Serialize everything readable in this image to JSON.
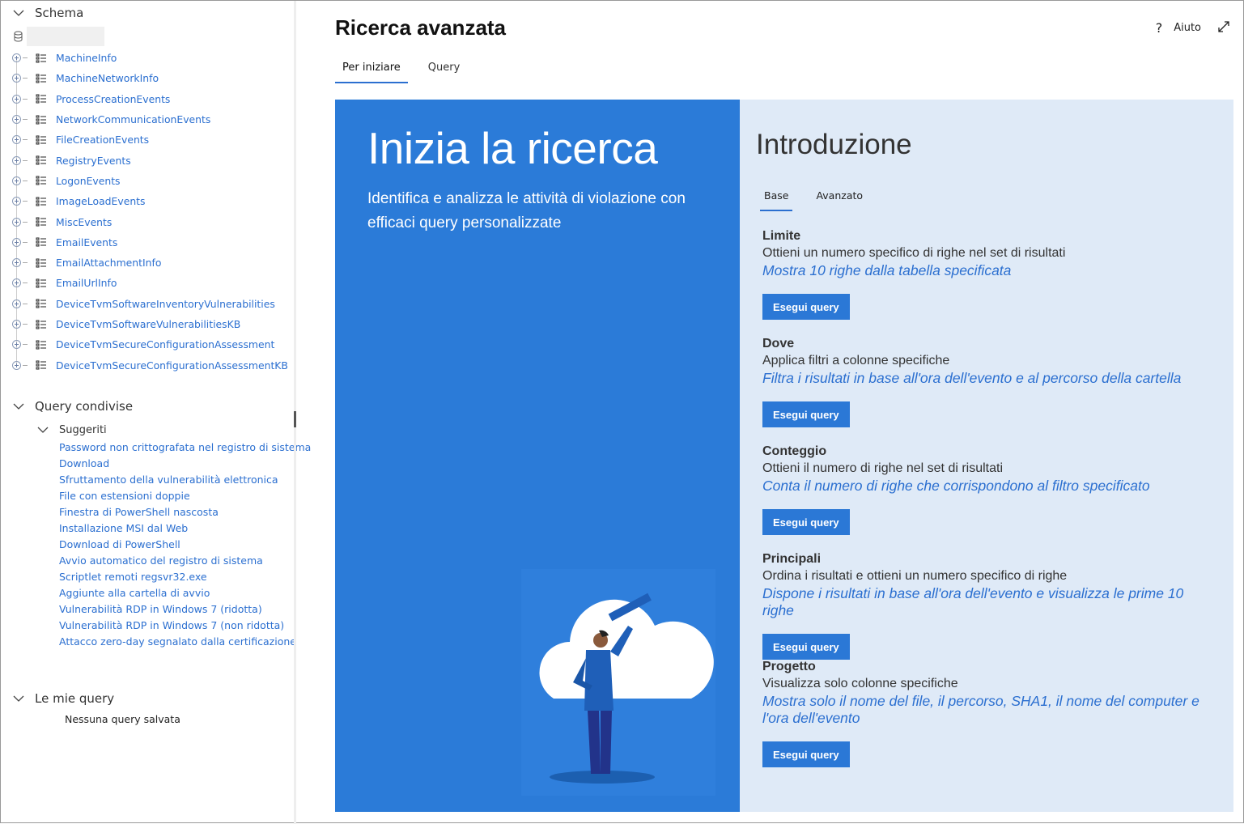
{
  "sidebar": {
    "schema_label": "Schema",
    "tables": [
      "MachineInfo",
      "MachineNetworkInfo",
      "ProcessCreationEvents",
      "NetworkCommunicationEvents",
      "FileCreationEvents",
      "RegistryEvents",
      "LogonEvents",
      "ImageLoadEvents",
      "MiscEvents",
      "EmailEvents",
      "EmailAttachmentInfo",
      "EmailUrlInfo",
      "DeviceTvmSoftwareInventoryVulnerabilities",
      "DeviceTvmSoftwareVulnerabilitiesKB",
      "DeviceTvmSecureConfigurationAssessment",
      "DeviceTvmSecureConfigurationAssessmentKB"
    ],
    "shared_label": "Query condivise",
    "suggested_label": "Suggeriti",
    "suggested": [
      "Password non crittografata nel registro di sistema",
      "Download",
      "Sfruttamento della vulnerabilità elettronica",
      "File con estensioni doppie",
      "Finestra di PowerShell nascosta",
      "Installazione MSI dal Web",
      "Download di PowerShell",
      "Avvio automatico del registro di sistema",
      "Scriptlet remoti regsvr32.exe",
      "Aggiunte alla cartella di avvio",
      "Vulnerabilità RDP in Windows 7 (ridotta)",
      "Vulnerabilità RDP in Windows 7 (non ridotta)",
      "Attacco zero-day segnalato dalla certificazione"
    ],
    "my_label": "Le mie query",
    "my_empty": "Nessuna query salvata"
  },
  "header": {
    "title": "Ricerca avanzata",
    "help": "Aiuto",
    "tabs": [
      "Per iniziare",
      "Query"
    ]
  },
  "hero": {
    "title": "Inizia la ricerca",
    "subtitle": "Identifica e analizza le attività di violazione con efficaci query personalizzate"
  },
  "intro": {
    "title": "Introduzione",
    "tabs": [
      "Base",
      "Avanzato"
    ],
    "examples": [
      {
        "title": "Limite",
        "desc": "Ottieni un numero specifico di righe nel set di risultati",
        "link": "Mostra 10 righe dalla tabella specificata",
        "button": "Esegui query"
      },
      {
        "title": "Dove",
        "desc": "Applica filtri a colonne specifiche",
        "link": "Filtra i risultati in base all'ora dell'evento e al percorso della cartella",
        "button": "Esegui query"
      },
      {
        "title": "Conteggio",
        "desc": "Ottieni il numero di righe nel set di risultati",
        "link": "Conta il numero di righe che corrispondono al filtro specificato",
        "button": "Esegui query"
      },
      {
        "title": "Principali",
        "desc": "Ordina i risultati e ottieni un numero specifico di righe",
        "link": "Dispone i risultati in base all'ora dell'evento e visualizza le prime 10 righe",
        "button": "Esegui query"
      },
      {
        "title": "Progetto",
        "desc": "Visualizza solo colonne specifiche",
        "link": "Mostra solo il nome del file, il percorso, SHA1, il nome del computer e l'ora dell'evento",
        "button": "Esegui query"
      }
    ]
  },
  "colors": {
    "accent": "#2b6fd0",
    "hero": "#2b7bd8",
    "intro_bg": "#dfeaf7"
  }
}
